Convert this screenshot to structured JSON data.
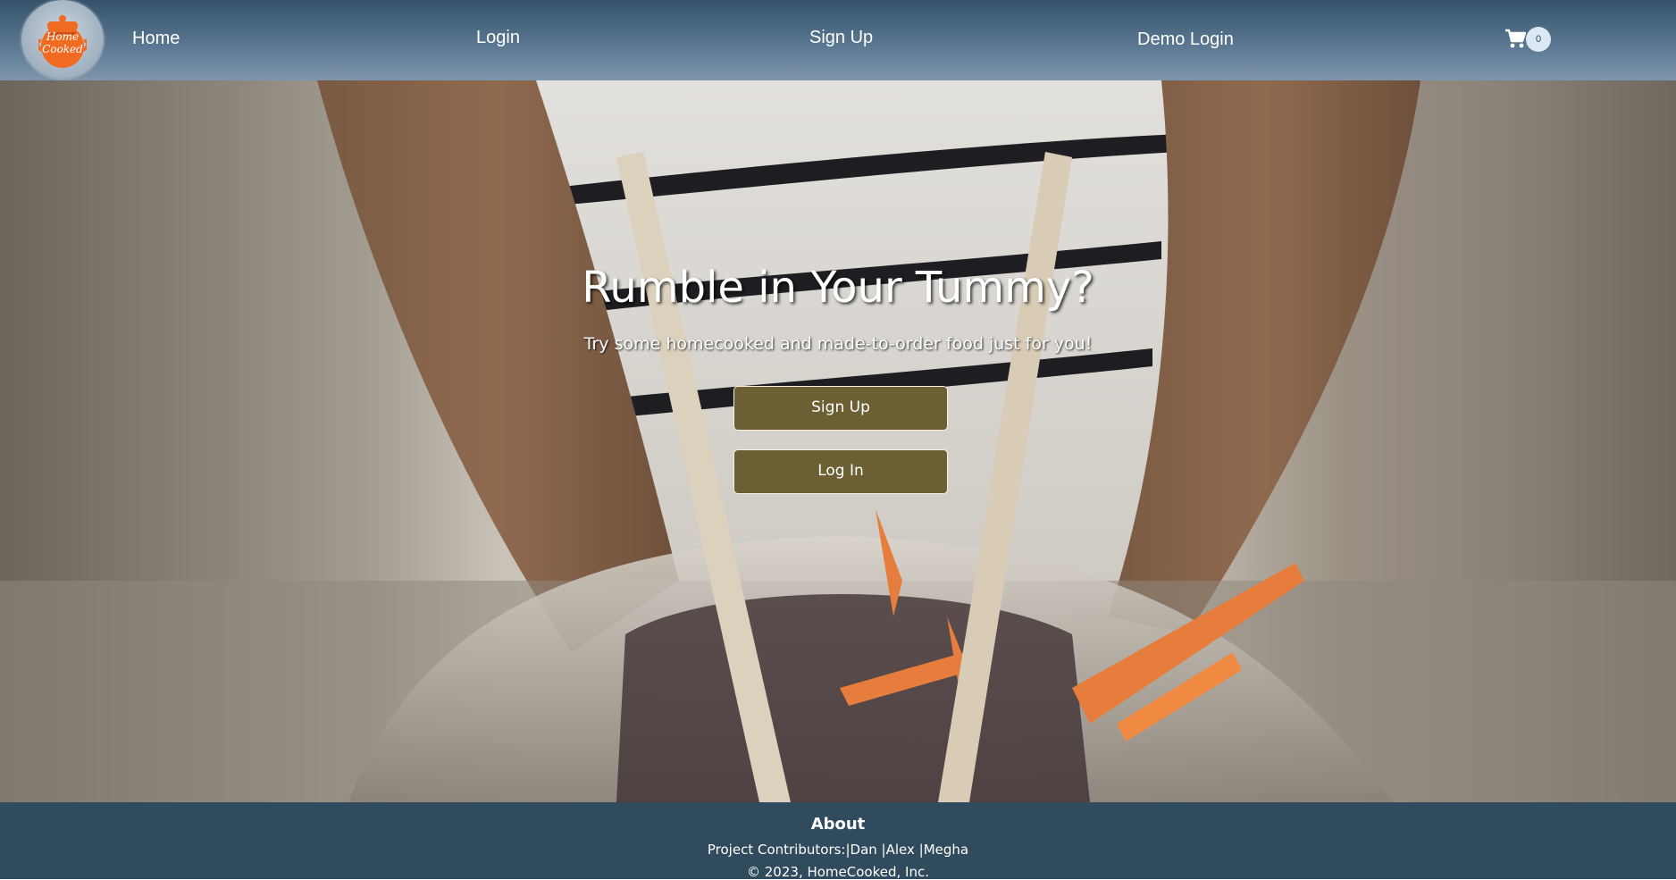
{
  "nav": {
    "logo_text_line1": "Home",
    "logo_text_line2": "Cooked",
    "home": "Home",
    "login": "Login",
    "signup": "Sign Up",
    "demo_login": "Demo Login",
    "cart_count": "0",
    "cart_icon": "shopping-cart-icon"
  },
  "hero": {
    "title": "Rumble in Your Tummy?",
    "subtitle": "Try some homecooked and made-to-order food just for you!",
    "signup_button": "Sign Up",
    "login_button": "Log In"
  },
  "footer": {
    "title": "About",
    "contributors": "Project Contributors:|Dan |Alex |Megha",
    "copyright": "© 2023, HomeCooked, Inc."
  },
  "colors": {
    "nav_top": "#36536b",
    "nav_bottom": "#7e96ab",
    "button_fill": "#6c5f34",
    "footer_bg": "#304a5e",
    "logo_pot": "#f26b22"
  }
}
